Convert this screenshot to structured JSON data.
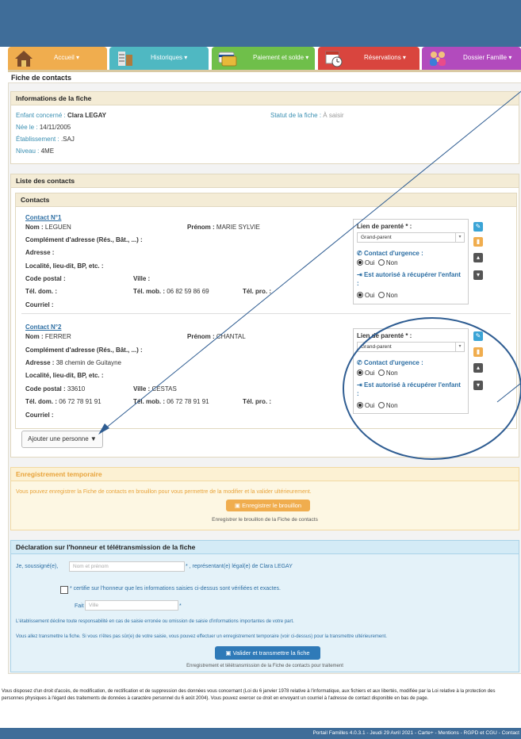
{
  "nav": {
    "tabs": [
      {
        "label": "Accueil ▾"
      },
      {
        "label": "Historiques ▾"
      },
      {
        "label": "Paiement et solde ▾"
      },
      {
        "label": "Réservations ▾"
      },
      {
        "label": "Dossier Famille ▾"
      }
    ]
  },
  "page_title": "Fiche de contacts",
  "info": {
    "header": "Informations de la fiche",
    "enfant_label": "Enfant concerné :",
    "enfant_value": "Clara LEGAY",
    "nee_label": "Née le :",
    "nee_value": "14/11/2005",
    "etab_label": "Établissement :",
    "etab_value": ".SAJ",
    "niveau_label": "Niveau :",
    "niveau_value": "4ME",
    "statut_label": "Statut de la fiche :",
    "statut_value": "À saisir"
  },
  "liste": {
    "header": "Liste des contacts",
    "contacts_header": "Contacts",
    "labels": {
      "nom": "Nom :",
      "prenom": "Prénom :",
      "complement": "Complément d'adresse (Rés., Bât., ...) :",
      "adresse": "Adresse :",
      "localite": "Localité, lieu-dit, BP, etc. :",
      "code_postal": "Code postal :",
      "ville": "Ville :",
      "tel_dom": "Tél. dom. :",
      "tel_mob": "Tél. mob. :",
      "tel_pro": "Tél. pro. :",
      "courriel": "Courriel :",
      "lien": "Lien de parenté * :",
      "urgence": "Contact d'urgence :",
      "autorise": "Est autorisé à récupérer l'enfant :",
      "oui": "Oui",
      "non": "Non"
    },
    "contacts": [
      {
        "title": "Contact N°1",
        "nom": "LEGUEN",
        "prenom": "MARIE SYLVIE",
        "adresse": "",
        "code_postal": "",
        "ville": "",
        "tel_dom": "",
        "tel_mob": "06 82 59 86 69",
        "lien": "Grand-parent"
      },
      {
        "title": "Contact N°2",
        "nom": "FERRER",
        "prenom": "CHANTAL",
        "adresse": "38 chemin de Guitayne",
        "code_postal": "33610",
        "ville": "CESTAS",
        "tel_dom": "06 72 78 91 91",
        "tel_mob": "06 72 78 91 91",
        "lien": "Grand-parent"
      }
    ],
    "add_button": "Ajouter une personne ▼"
  },
  "brouillon": {
    "header": "Enregistrement temporaire",
    "text": "Vous pouvez enregistrer la Fiche de contacts en brouillon pour vous permettre de la modifier et la valider ultérieurement.",
    "button": "Enregistrer le brouillon",
    "caption": "Enregistrer le brouillon de la Fiche de contacts"
  },
  "declaration": {
    "header": "Déclaration sur l'honneur et télétransmission de la fiche",
    "je": "Je, soussigné(e),",
    "nom_placeholder": "Nom et prénom",
    "representant": "* , représentant(e) légal(e) de Clara LEGAY",
    "certifie": "* certifie sur l'honneur que les informations saisies ci-dessus sont vérifiées et exactes.",
    "fait_a": "Fait à",
    "ville_placeholder": "Ville",
    "star": "*",
    "decline": "L'établissement décline toute responsabilité en cas de saisie erronée ou omission de saisie d'informations importantes de votre part.",
    "transmettre": "Vous allez transmettre la fiche. Si vous n'êtes pas sûr(e) de votre saisie, vous pouvez effectuer un enregistrement temporaire (voir ci-dessus) pour la transmettre ultérieurement.",
    "button": "Valider et transmettre la fiche",
    "caption": "Enregistrement et télétransmission de la Fiche de contacts pour traitement"
  },
  "legal": "Vous disposez d'un droit d'accès, de modification, de rectification et de suppression des données vous concernant (Loi du 6 janvier 1978 relative à l'informatique, aux fichiers et aux libertés, modifiée par la Loi relative à la protection des personnes physiques à l'égard des traitements de données à caractère personnel du 6 août 2004). Vous pouvez exercer ce droit en envoyant un courriel à l'adresse de contact disponible en bas de page.",
  "footer": "Portail Familles 4.0.3.1 - Jeudi 29 Avril 2021 - Carte+ - Mentions - RGPD et CGU - Contact",
  "colors": {
    "topbar": "#3f6d99",
    "accent_orange": "#f0ad4e",
    "accent_blue": "#2f7ab8",
    "label_blue": "#3a8fb2"
  },
  "icons": [
    "house-icon",
    "ruler-icon",
    "visa-card-icon",
    "calendar-clock-icon",
    "family-icon",
    "pencil-icon",
    "trash-icon",
    "arrow-up-icon",
    "arrow-down-icon",
    "phone-icon",
    "sign-in-icon",
    "save-icon"
  ]
}
